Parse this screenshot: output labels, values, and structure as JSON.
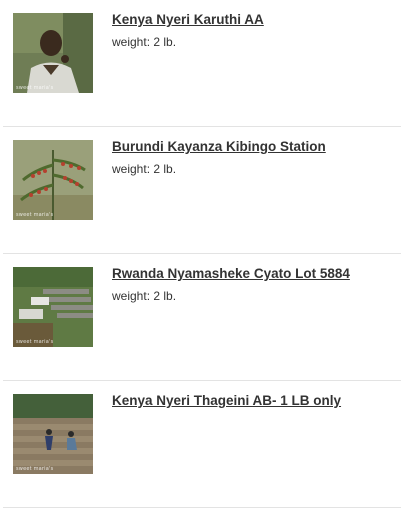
{
  "products": [
    {
      "title": "Kenya Nyeri Karuthi AA",
      "weight_label": "weight:",
      "weight_value": "2 lb.",
      "image_icon": "farmer-photo",
      "watermark": "sweet maria's"
    },
    {
      "title": "Burundi Kayanza Kibingo Station",
      "weight_label": "weight:",
      "weight_value": "2 lb.",
      "image_icon": "coffee-cherries-photo",
      "watermark": "sweet maria's"
    },
    {
      "title": "Rwanda Nyamasheke Cyato Lot 5884",
      "weight_label": "weight:",
      "weight_value": "2 lb.",
      "image_icon": "drying-beds-photo",
      "watermark": "sweet maria's"
    },
    {
      "title": "Kenya Nyeri Thageini AB- 1 LB only",
      "image_icon": "workers-drying-photo",
      "watermark": "sweet maria's"
    }
  ]
}
